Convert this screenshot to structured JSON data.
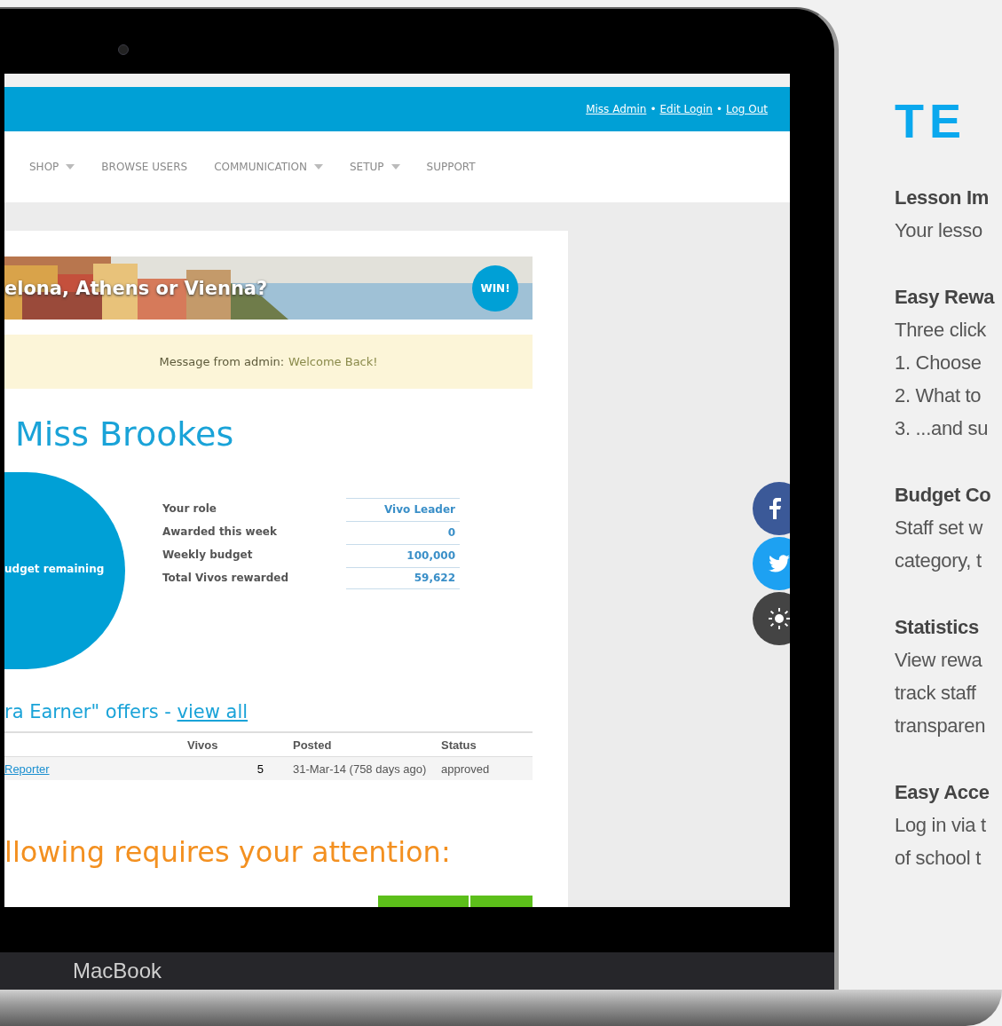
{
  "screen": {
    "user_links": [
      "Miss Admin",
      "Edit Login",
      "Log Out"
    ],
    "link_separator": "•",
    "nav": [
      {
        "label": "SHOP",
        "dropdown": true
      },
      {
        "label": "BROWSE USERS",
        "dropdown": false
      },
      {
        "label": "COMMUNICATION",
        "dropdown": true
      },
      {
        "label": "SETUP",
        "dropdown": true
      },
      {
        "label": "SUPPORT",
        "dropdown": false
      }
    ],
    "banner": {
      "kind": "picture",
      "headline": "elona, Athens or Vienna?",
      "badge": "WIN!"
    },
    "message": {
      "label": "Message from admin:",
      "text": "Welcome Back!"
    },
    "greeting": "Miss Brookes",
    "budget_label": "udget remaining",
    "stats": [
      {
        "label": "Your role",
        "value": "Vivo Leader"
      },
      {
        "label": "Awarded this week",
        "value": "0"
      },
      {
        "label": "Weekly budget",
        "value": "100,000"
      },
      {
        "label": "Total Vivos rewarded",
        "value": "59,622"
      }
    ],
    "offers": {
      "heading": "ra Earner\" offers - ",
      "link": "view all",
      "columns": [
        "Vivos",
        "Posted",
        "Status"
      ],
      "rows": [
        {
          "name": "Reporter",
          "vivos": "5",
          "posted": "31-Mar-14 (758 days ago)",
          "status": "approved"
        }
      ]
    },
    "attention_heading": "llowing requires your attention:",
    "social": [
      {
        "kind": "facebook"
      },
      {
        "kind": "twitter"
      },
      {
        "kind": "light"
      }
    ]
  },
  "laptop_label": "MacBook",
  "features": {
    "title": "TE",
    "sections": [
      {
        "heading": "Lesson Im",
        "lines": [
          "Your lesso"
        ]
      },
      {
        "heading": "Easy Rewa",
        "lines": [
          "Three click",
          "1. Choose",
          "2. What to",
          "3. ...and su"
        ]
      },
      {
        "heading": "Budget Co",
        "lines": [
          "Staff set w",
          "category, t"
        ]
      },
      {
        "heading": "Statistics",
        "lines": [
          "View rewa",
          "track staff",
          "transparen"
        ]
      },
      {
        "heading": "Easy Acce",
        "lines": [
          "Log in via t",
          "of school t"
        ]
      }
    ]
  }
}
